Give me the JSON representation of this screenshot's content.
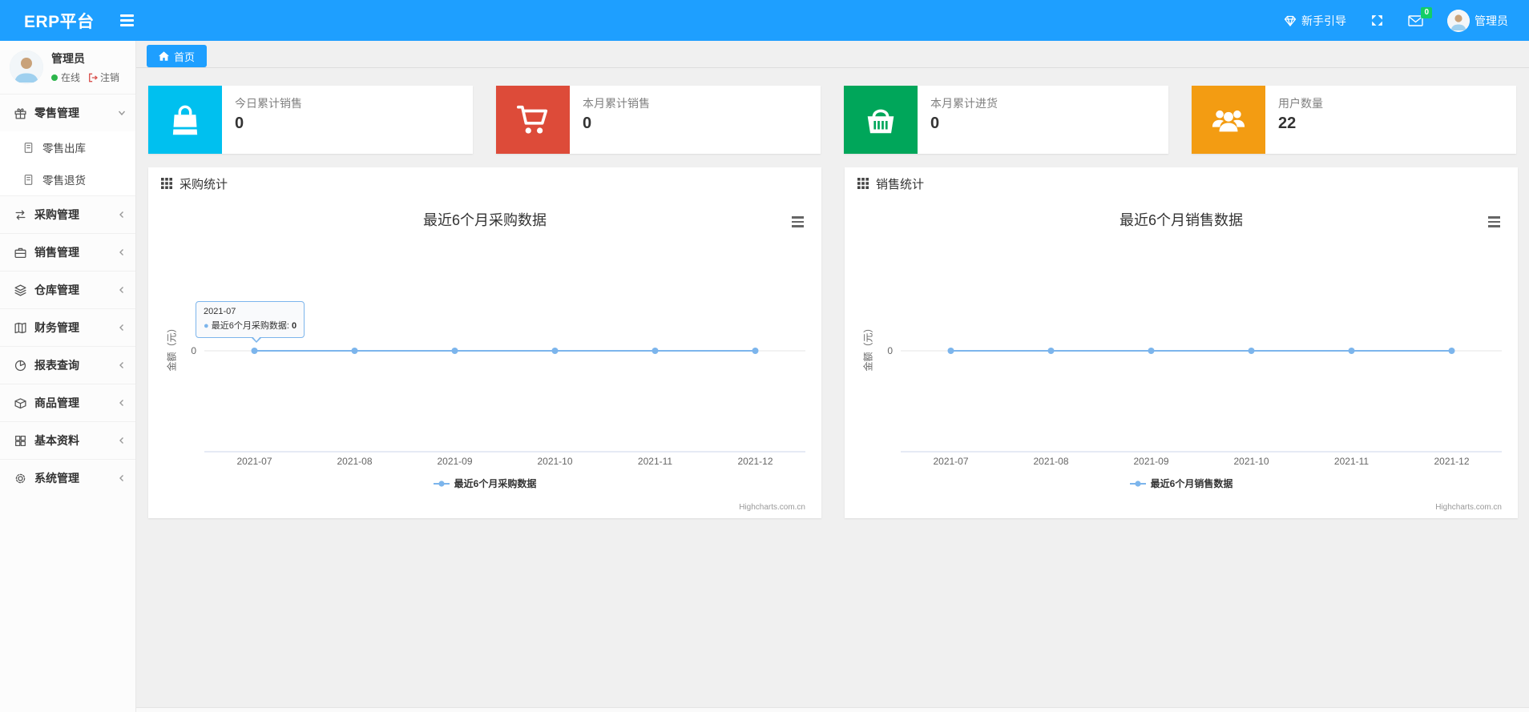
{
  "navbar": {
    "brand": "ERP平台",
    "guide_label": "新手引导",
    "message_badge": "0",
    "username": "管理员"
  },
  "sidebar": {
    "user": {
      "name": "管理员",
      "status": "在线",
      "logout": "注销"
    },
    "menu": [
      {
        "label": "零售管理",
        "icon": "gift-icon",
        "expanded": true,
        "children": [
          {
            "label": "零售出库",
            "icon": "file-icon"
          },
          {
            "label": "零售退货",
            "icon": "file-icon"
          }
        ]
      },
      {
        "label": "采购管理",
        "icon": "repeat-icon"
      },
      {
        "label": "销售管理",
        "icon": "briefcase-icon"
      },
      {
        "label": "仓库管理",
        "icon": "layers-icon"
      },
      {
        "label": "财务管理",
        "icon": "book-icon"
      },
      {
        "label": "报表查询",
        "icon": "pie-clock-icon"
      },
      {
        "label": "商品管理",
        "icon": "box-icon"
      },
      {
        "label": "基本资料",
        "icon": "grid-icon"
      },
      {
        "label": "系统管理",
        "icon": "gear-icon"
      }
    ]
  },
  "tabs": {
    "home": "首页"
  },
  "stats": [
    {
      "label": "今日累计销售",
      "value": "0",
      "color": "#00c0ef",
      "icon": "shopping-bag-icon"
    },
    {
      "label": "本月累计销售",
      "value": "0",
      "color": "#dd4b39",
      "icon": "cart-icon"
    },
    {
      "label": "本月累计进货",
      "value": "0",
      "color": "#00a65a",
      "icon": "basket-icon"
    },
    {
      "label": "用户数量",
      "value": "22",
      "color": "#f39c12",
      "icon": "users-icon"
    }
  ],
  "panels": [
    {
      "title": "采购统计"
    },
    {
      "title": "销售统计"
    }
  ],
  "chart_data": [
    {
      "type": "line",
      "title": "最近6个月采购数据",
      "categories": [
        "2021-07",
        "2021-08",
        "2021-09",
        "2021-10",
        "2021-11",
        "2021-12"
      ],
      "series": [
        {
          "name": "最近6个月采购数据",
          "values": [
            0,
            0,
            0,
            0,
            0,
            0
          ]
        }
      ],
      "xlabel": "",
      "ylabel": "金额（元）",
      "yticks": [
        "0"
      ],
      "ylim": [
        -1,
        1
      ],
      "grid": "zero-line-only",
      "legend_position": "bottom",
      "color": "#7cb5ec",
      "credits": "Highcharts.com.cn",
      "tooltip": {
        "header": "2021-07",
        "series": "最近6个月采购数据",
        "separator": ": ",
        "value": "0",
        "point_index": 0
      }
    },
    {
      "type": "line",
      "title": "最近6个月销售数据",
      "categories": [
        "2021-07",
        "2021-08",
        "2021-09",
        "2021-10",
        "2021-11",
        "2021-12"
      ],
      "series": [
        {
          "name": "最近6个月销售数据",
          "values": [
            0,
            0,
            0,
            0,
            0,
            0
          ]
        }
      ],
      "xlabel": "",
      "ylabel": "金额（元）",
      "yticks": [
        "0"
      ],
      "ylim": [
        -1,
        1
      ],
      "grid": "zero-line-only",
      "legend_position": "bottom",
      "color": "#7cb5ec",
      "credits": "Highcharts.com.cn"
    }
  ]
}
